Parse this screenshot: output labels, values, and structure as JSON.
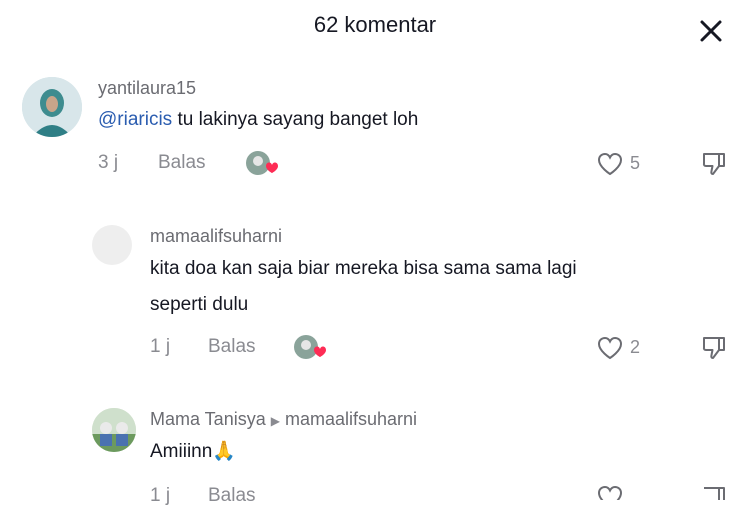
{
  "header": {
    "title": "62 komentar",
    "close_icon": "close-icon"
  },
  "comments": [
    {
      "username": "yantilaura15",
      "mention": "@riaricis",
      "text": " tu lakinya sayang banget loh",
      "time": "3 j",
      "reply_label": "Balas",
      "likes": "5"
    },
    {
      "username": "mamaalifsuharni",
      "text_line1": "kita doa kan saja biar mereka bisa sama sama lagi",
      "text_line2": "seperti dulu",
      "time": "1 j",
      "reply_label": "Balas",
      "likes": "2"
    },
    {
      "username": "Mama Tanisya",
      "reply_to": "mamaalifsuharni",
      "text": "Amiiinn",
      "emoji": "🙏",
      "time": "1 j",
      "reply_label": "Balas"
    }
  ],
  "icons": {
    "heart": "heart-outline-icon",
    "dislike": "thumbs-down-icon",
    "close": "close-icon"
  }
}
